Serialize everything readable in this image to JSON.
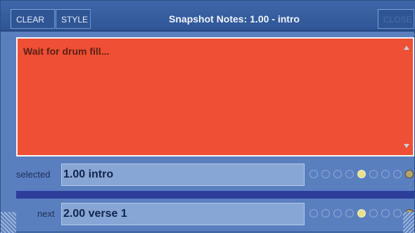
{
  "toolbar": {
    "clear_label": "CLEAR",
    "style_label": "STYLE",
    "close_label": "CLOSE"
  },
  "window": {
    "title": "Snapshot Notes: 1.00 - intro"
  },
  "notes": {
    "text": "Wait for drum fill...",
    "bg_color": "#ef4f34"
  },
  "selected": {
    "label": "selected",
    "value": "1.00  intro",
    "dot_count": 9,
    "active_dot": 5
  },
  "next": {
    "label": "next",
    "value": "2.00  verse 1",
    "dot_count": 9,
    "active_dot": 5
  },
  "icons": {
    "scroll_up": "scroll-up-icon",
    "scroll_down": "scroll-down-icon",
    "end_marker": "end-marker-icon"
  }
}
